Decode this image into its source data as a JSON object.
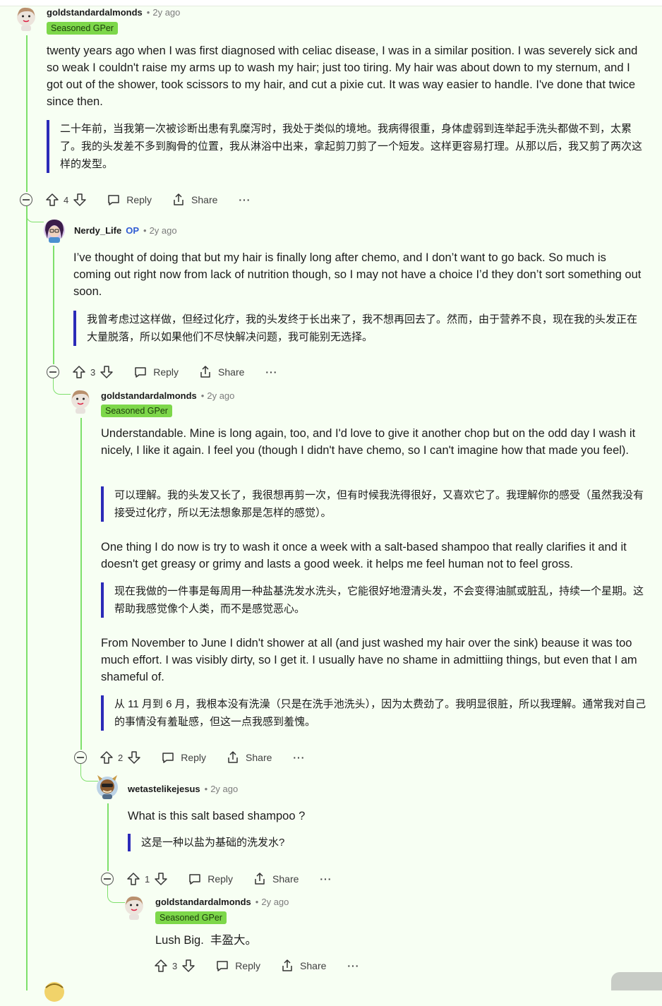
{
  "comments": [
    {
      "username": "goldstandardalmonds",
      "separator": "•",
      "age": "2y ago",
      "flair": "Seasoned GPer",
      "paragraphs": [
        {
          "text": "twenty years ago when I was first diagnosed with celiac disease, I was in a similar position. I was severely sick and so weak I couldn't raise my arms up to wash my hair; just too tiring. My hair was about down to my sternum, and I got out of the shower, took scissors to my hair, and cut a pixie cut. It was way easier to handle. I've done that twice since then.",
          "translation": "二十年前，当我第一次被诊断出患有乳糜泻时，我处于类似的境地。我病得很重，身体虚弱到连举起手洗头都做不到，太累了。我的头发差不多到胸骨的位置，我从淋浴中出来，拿起剪刀剪了一个短发。这样更容易打理。从那以后，我又剪了两次这样的发型。"
        }
      ],
      "votes": "4",
      "reply_label": "Reply",
      "share_label": "Share",
      "more_label": "···"
    },
    {
      "username": "Nerdy_Life",
      "op_label": "OP",
      "separator": "•",
      "age": "2y ago",
      "paragraphs": [
        {
          "text": "I’ve thought of doing that but my hair is finally long after chemo, and I don’t want to go back. So much is coming out right now from lack of nutrition though, so I may not have a choice I’d they don’t sort something out soon.",
          "translation": "我曾考虑过这样做，但经过化疗，我的头发终于长出来了，我不想再回去了。然而，由于营养不良，现在我的头发正在大量脱落，所以如果他们不尽快解决问题，我可能别无选择。"
        }
      ],
      "votes": "3",
      "reply_label": "Reply",
      "share_label": "Share",
      "more_label": "···"
    },
    {
      "username": "goldstandardalmonds",
      "separator": "•",
      "age": "2y ago",
      "flair": "Seasoned GPer",
      "paragraphs": [
        {
          "text": "Understandable. Mine is long again, too, and I'd love to give it another chop but on the odd day I wash it nicely, I like it again. I feel you (though I didn't have chemo, so I can't imagine how that made you feel).",
          "translation": "可以理解。我的头发又长了，我很想再剪一次，但有时候我洗得很好，又喜欢它了。我理解你的感受（虽然我没有接受过化疗，所以无法想象那是怎样的感觉）。"
        },
        {
          "text": "One thing I do now is try to wash it once a week with a salt-based shampoo that really clarifies it and it doesn't get greasy or grimy and lasts a good week. it helps me feel human not to feel gross.",
          "translation": "现在我做的一件事是每周用一种盐基洗发水洗头，它能很好地澄清头发，不会变得油腻或脏乱，持续一个星期。这帮助我感觉像个人类，而不是感觉恶心。"
        },
        {
          "text": "From November to June I didn't shower at all (and just washed my hair over the sink) beause it was too much effort. I was visibly dirty, so I get it. I usually have no shame in admittiing things, but even that I am shameful of.",
          "translation": "从 11 月到 6 月，我根本没有洗澡（只是在洗手池洗头），因为太费劲了。我明显很脏，所以我理解。通常我对自己的事情没有羞耻感，但这一点我感到羞愧。"
        }
      ],
      "votes": "2",
      "reply_label": "Reply",
      "share_label": "Share",
      "more_label": "···"
    },
    {
      "username": "wetastelikejesus",
      "separator": "•",
      "age": "2y ago",
      "paragraphs": [
        {
          "text": "What is this salt based shampoo ?",
          "translation": "这是一种以盐为基础的洗发水?"
        }
      ],
      "votes": "1",
      "reply_label": "Reply",
      "share_label": "Share",
      "more_label": "···"
    },
    {
      "username": "goldstandardalmonds",
      "separator": "•",
      "age": "2y ago",
      "flair": "Seasoned GPer",
      "paragraphs": [
        {
          "text": "Lush Big.  丰盈大。"
        }
      ],
      "votes": "3",
      "reply_label": "Reply",
      "share_label": "Share",
      "more_label": "···"
    }
  ],
  "colors": {
    "background": "#f7fff3",
    "thread_line": "#7ee06b",
    "flair_bg": "#7dd74a",
    "quote_bar": "#2b2bb8",
    "op": "#2f5bd3"
  },
  "icons": [
    "upvote-icon",
    "downvote-icon",
    "reply-icon",
    "share-icon",
    "collapse-icon",
    "more-icon"
  ]
}
